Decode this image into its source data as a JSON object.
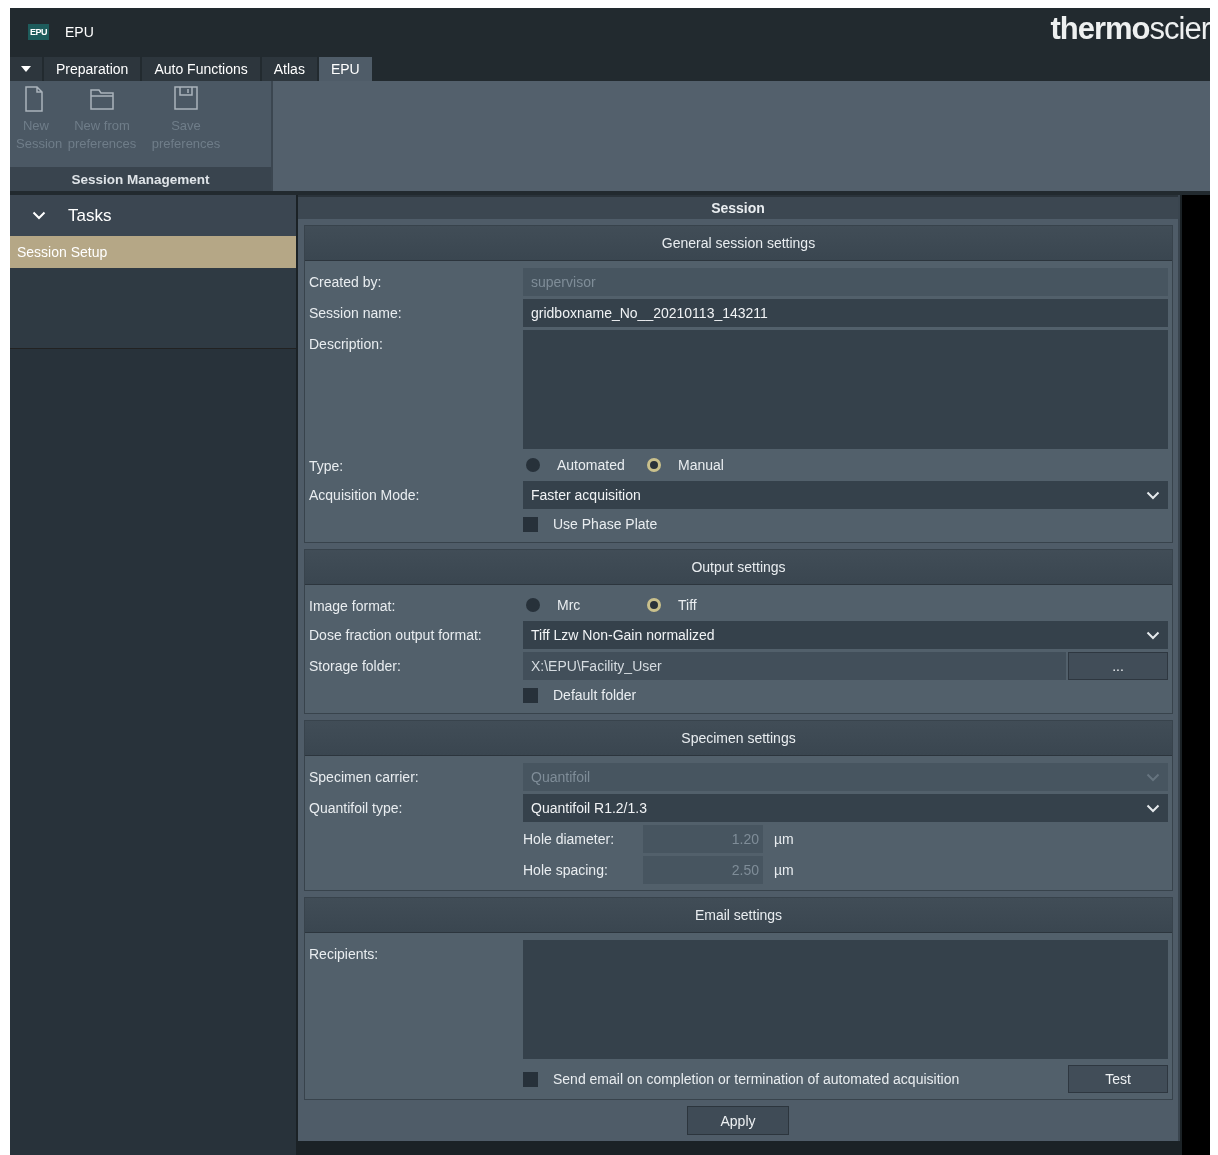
{
  "app": {
    "badge": "EPU",
    "title": "EPU",
    "logo": "**thermo**scier"
  },
  "tabs": [
    {
      "label": "Preparation",
      "selected": false
    },
    {
      "label": "Auto Functions",
      "selected": false
    },
    {
      "label": "Atlas",
      "selected": false
    },
    {
      "label": "EPU",
      "selected": true
    }
  ],
  "ribbon": {
    "group": "Session Management",
    "buttons": [
      {
        "kind": "new",
        "label": "New Session",
        "disabled": true
      },
      {
        "kind": "open",
        "label": "New from preferences",
        "disabled": true
      },
      {
        "kind": "save",
        "label": "Save preferences",
        "disabled": true
      }
    ]
  },
  "tasks": {
    "title": "Tasks",
    "expanded": true,
    "items": [
      {
        "label": "Session Setup",
        "selected": true
      }
    ]
  },
  "panel": {
    "title": "Session",
    "apply": "Apply",
    "sections": [
      {
        "title": "General session settings",
        "rows": [
          {
            "kind": "text",
            "label": "Created by:",
            "value": "supervisor",
            "disabled": true
          },
          {
            "kind": "text",
            "label": "Session name:",
            "value": "gridboxname_No__20210113_143211",
            "disabled": false
          },
          {
            "kind": "textarea",
            "label": "Description:"
          },
          {
            "kind": "radio",
            "label": "Type:",
            "options": [
              {
                "label": "Automated",
                "selected": false
              },
              {
                "label": "Manual",
                "selected": true
              }
            ]
          },
          {
            "kind": "dropdown",
            "label": "Acquisition Mode:",
            "value": "Faster acquisition",
            "disabled": false
          },
          {
            "kind": "checkbox",
            "text": "Use Phase Plate",
            "checked": false
          }
        ]
      },
      {
        "title": "Output settings",
        "rows": [
          {
            "kind": "radio",
            "label": "Image format:",
            "options": [
              {
                "label": "Mrc",
                "selected": false
              },
              {
                "label": "Tiff",
                "selected": true
              }
            ]
          },
          {
            "kind": "dropdown",
            "label": "Dose fraction output format:",
            "value": "Tiff Lzw Non-Gain normalized",
            "disabled": false
          },
          {
            "kind": "folder",
            "label": "Storage folder:",
            "value": "X:\\EPU\\Facility_User",
            "button": "..."
          },
          {
            "kind": "checkbox",
            "text": "Default folder",
            "checked": false
          }
        ]
      },
      {
        "title": "Specimen settings",
        "rows": [
          {
            "kind": "dropdown",
            "label": "Specimen carrier:",
            "value": "Quantifoil",
            "disabled": true
          },
          {
            "kind": "dropdown",
            "label": "Quantifoil type:",
            "value": "Quantifoil R1.2/1.3",
            "disabled": false
          },
          {
            "kind": "numeric",
            "label": "Hole diameter:",
            "value": "1.20",
            "unit": "µm",
            "disabled": true
          },
          {
            "kind": "numeric",
            "label": "Hole spacing:",
            "value": "2.50",
            "unit": "µm",
            "disabled": true
          }
        ]
      },
      {
        "title": "Email settings",
        "rows": [
          {
            "kind": "textarea",
            "label": "Recipients:"
          },
          {
            "kind": "checkbutton",
            "text": "Send email on completion or termination of automated acquisition",
            "checked": false,
            "button": "Test"
          }
        ]
      }
    ]
  }
}
